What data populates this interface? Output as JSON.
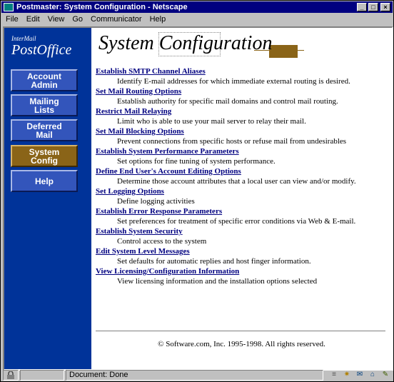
{
  "window": {
    "title": "Postmaster: System Configuration - Netscape"
  },
  "menu": [
    "File",
    "Edit",
    "View",
    "Go",
    "Communicator",
    "Help"
  ],
  "logo": {
    "line1": "InterMail",
    "line2": "PostOffice"
  },
  "nav": [
    {
      "label1": "Account",
      "label2": "Admin",
      "active": false
    },
    {
      "label1": "Mailing",
      "label2": "Lists",
      "active": false
    },
    {
      "label1": "Deferred",
      "label2": "Mail",
      "active": false
    },
    {
      "label1": "System",
      "label2": "Config",
      "active": true
    },
    {
      "label1": "Help",
      "label2": "",
      "active": false
    }
  ],
  "page": {
    "title": "System Configuration"
  },
  "items": [
    {
      "link": "Establish SMTP Channel Aliases",
      "desc": "Identify E-mail addresses for which immediate external routing is desired."
    },
    {
      "link": "Set Mail Routing Options",
      "desc": "Establish authority for specific mail domains and control mail routing."
    },
    {
      "link": "Restrict Mail Relaying",
      "desc": "Limit who is able to use your mail server to relay their mail."
    },
    {
      "link": "Set Mail Blocking Options",
      "desc": "Prevent connections from specific hosts or refuse mail from undesirables"
    },
    {
      "link": "Establish System Performance Parameters",
      "desc": "Set options for fine tuning of system performance."
    },
    {
      "link": "Define End User's Account Editing Options",
      "desc": "Determine those account attributes that a local user can view and/or modify."
    },
    {
      "link": "Set Logging Options",
      "desc": "Define logging activities"
    },
    {
      "link": "Establish Error Response Parameters",
      "desc": "Set preferences for treatment of specific error conditions via Web & E-mail."
    },
    {
      "link": "Establish System Security",
      "desc": "Control access to the system"
    },
    {
      "link": "Edit System Level Messages",
      "desc": "Set defaults for automatic replies and host finger information."
    },
    {
      "link": "View Licensing/Configuration Information",
      "desc": "View licensing information and the installation options selected"
    }
  ],
  "footer": {
    "copyright": "© Software.com, Inc. 1995-1998. All rights reserved."
  },
  "status": {
    "text": "Document: Done"
  }
}
